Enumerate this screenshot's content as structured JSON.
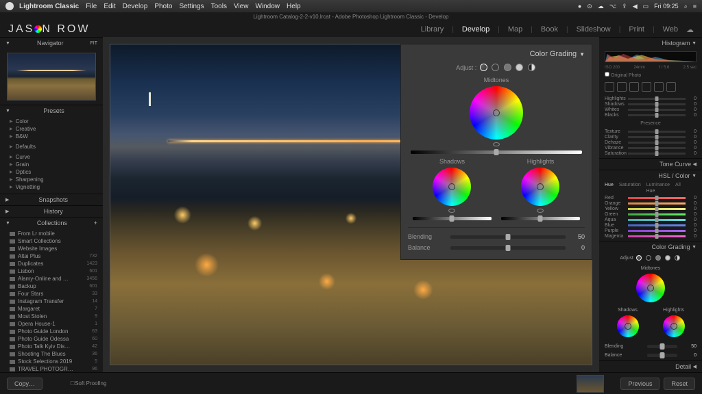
{
  "menubar": {
    "app": "Lightroom Classic",
    "items": [
      "File",
      "Edit",
      "Develop",
      "Photo",
      "Settings",
      "Tools",
      "View",
      "Window",
      "Help"
    ],
    "clock": "Fri 09:25"
  },
  "docbar": {
    "title": "Lightroom Catalog-2-2-v10.lrcat - Adobe Photoshop Lightroom Classic - Develop"
  },
  "brand": {
    "pre": "JAS",
    "post": "N ROW"
  },
  "modules": [
    "Library",
    "Develop",
    "Map",
    "Book",
    "Slideshow",
    "Print",
    "Web"
  ],
  "activeModule": "Develop",
  "left": {
    "navigator": {
      "title": "Navigator",
      "mode": "FIT"
    },
    "presets": {
      "title": "Presets",
      "groups": [
        "Color",
        "Creative",
        "B&W"
      ],
      "defaults": "Defaults",
      "user": [
        "Curve",
        "Grain",
        "Optics",
        "Sharpening",
        "Vignetting"
      ]
    },
    "snapshots": {
      "title": "Snapshots"
    },
    "history": {
      "title": "History"
    },
    "collections": {
      "title": "Collections",
      "items": [
        {
          "name": "From Lr mobile",
          "count": ""
        },
        {
          "name": "Smart Collections",
          "count": ""
        },
        {
          "name": "Website Images",
          "count": ""
        },
        {
          "name": "Altai Plus",
          "count": "732"
        },
        {
          "name": "Duplicates",
          "count": "1423"
        },
        {
          "name": "Lisbon",
          "count": "601"
        },
        {
          "name": "Alamy-Online and …",
          "count": "3456"
        },
        {
          "name": "Backup",
          "count": "601"
        },
        {
          "name": "Four Stars",
          "count": "33"
        },
        {
          "name": "Instagram Transfer",
          "count": "14"
        },
        {
          "name": "Margaret",
          "count": "7"
        },
        {
          "name": "Most Stolen",
          "count": "9"
        },
        {
          "name": "Opera House-1",
          "count": "1"
        },
        {
          "name": "Photo Guide London",
          "count": "63"
        },
        {
          "name": "Photo Guide Odessa",
          "count": "60"
        },
        {
          "name": "Photo Talk Kyiv Dis…",
          "count": "42"
        },
        {
          "name": "Shooting The Blues",
          "count": "36"
        },
        {
          "name": "Stock Selections 2019",
          "count": "5"
        },
        {
          "name": "TRAVEL PHOTOGR…",
          "count": "96"
        }
      ]
    },
    "copyBtn": "Copy…",
    "softProof": "Soft Proofing"
  },
  "colorGrading": {
    "title": "Color Grading",
    "adjustLabel": "Adjust :",
    "midtones": "Midtones",
    "shadows": "Shadows",
    "highlights": "Highlights",
    "blending": {
      "label": "Blending",
      "value": "50",
      "pct": 50
    },
    "balance": {
      "label": "Balance",
      "value": "0",
      "pct": 50
    }
  },
  "right": {
    "histogram": {
      "title": "Histogram",
      "iso": "ISO 200",
      "lens": "24mm",
      "ap": "f / 5.6",
      "sh": "2.5 sec"
    },
    "originalPhoto": "Original Photo",
    "basic": {
      "rows": [
        {
          "lbl": "Highlights",
          "v": "0"
        },
        {
          "lbl": "Shadows",
          "v": "0"
        },
        {
          "lbl": "Whites",
          "v": "0"
        },
        {
          "lbl": "Blacks",
          "v": "0"
        }
      ],
      "presence": "Presence",
      "prows": [
        {
          "lbl": "Texture",
          "v": "0"
        },
        {
          "lbl": "Clarity",
          "v": "0"
        },
        {
          "lbl": "Dehaze",
          "v": "0"
        },
        {
          "lbl": "Vibrance",
          "v": "0"
        },
        {
          "lbl": "Saturation",
          "v": "0"
        }
      ]
    },
    "toneCurve": "Tone Curve",
    "hsl": {
      "title": "HSL / Color",
      "tabs": [
        "Hue",
        "Saturation",
        "Luminance",
        "All"
      ],
      "activeTab": "Hue",
      "hueLabel": "Hue",
      "rows": [
        {
          "lbl": "Red",
          "cls": "red",
          "v": "0"
        },
        {
          "lbl": "Orange",
          "cls": "orange",
          "v": "0"
        },
        {
          "lbl": "Yellow",
          "cls": "yellow",
          "v": "0"
        },
        {
          "lbl": "Green",
          "cls": "green",
          "v": "0"
        },
        {
          "lbl": "Aqua",
          "cls": "aqua",
          "v": "0"
        },
        {
          "lbl": "Blue",
          "cls": "blue",
          "v": "0"
        },
        {
          "lbl": "Purple",
          "cls": "purple",
          "v": "0"
        },
        {
          "lbl": "Magenta",
          "cls": "magenta",
          "v": "0"
        }
      ]
    },
    "colorGradingTitle": "Color Grading",
    "miniCG": {
      "adjustLabel": "Adjust",
      "midtones": "Midtones",
      "shadows": "Shadows",
      "highlights": "Highlights",
      "blending": {
        "label": "Blending",
        "value": "50"
      },
      "balance": {
        "label": "Balance",
        "value": "0"
      }
    },
    "detail": "Detail",
    "previous": "Previous",
    "reset": "Reset"
  }
}
